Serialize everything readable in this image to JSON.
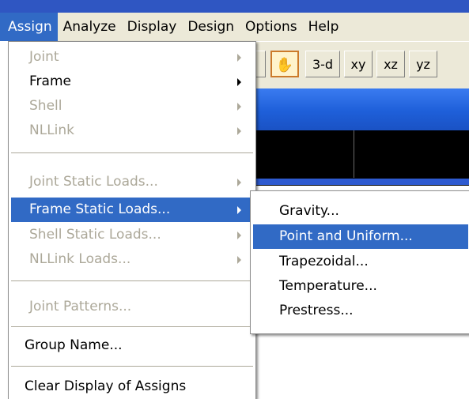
{
  "menubar": {
    "items": [
      "Assign",
      "Analyze",
      "Display",
      "Design",
      "Options",
      "Help"
    ]
  },
  "toolbar": {
    "buttons": [
      "3-d",
      "xy",
      "xz",
      "yz"
    ]
  },
  "assign_menu": {
    "items": [
      {
        "label": "Joint",
        "enabled": false,
        "submenu": true
      },
      {
        "label": "Frame",
        "enabled": true,
        "submenu": true
      },
      {
        "label": "Shell",
        "enabled": false,
        "submenu": true
      },
      {
        "label": "NLLink",
        "enabled": false,
        "submenu": true
      },
      {
        "label": "Joint Static Loads...",
        "enabled": false,
        "submenu": true
      },
      {
        "label": "Frame Static Loads...",
        "enabled": true,
        "submenu": true,
        "highlighted": true
      },
      {
        "label": "Shell Static Loads...",
        "enabled": false,
        "submenu": true
      },
      {
        "label": "NLLink Loads...",
        "enabled": false,
        "submenu": true
      },
      {
        "label": "Joint Patterns...",
        "enabled": false,
        "submenu": false
      },
      {
        "label": "Group Name...",
        "enabled": true,
        "submenu": false
      },
      {
        "label": "Clear Display of Assigns",
        "enabled": true,
        "submenu": false
      }
    ]
  },
  "frame_static_loads_submenu": {
    "items": [
      {
        "label": "Gravity...",
        "highlighted": false
      },
      {
        "label": "Point and Uniform...",
        "highlighted": true
      },
      {
        "label": "Trapezoidal...",
        "highlighted": false
      },
      {
        "label": "Temperature...",
        "highlighted": false
      },
      {
        "label": "Prestress...",
        "highlighted": false
      }
    ]
  },
  "colors": {
    "menu_highlight": "#316ac5",
    "disabled_text": "#aca899",
    "menubar_bg": "#ece9d8",
    "title_blue": "#1e5fd9",
    "canvas_bg": "#000000"
  },
  "icons": [
    "pan-hand-icon",
    "submenu-arrow-icon"
  ]
}
